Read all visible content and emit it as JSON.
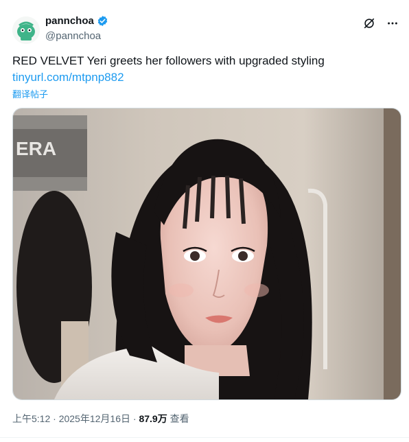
{
  "author": {
    "display_name": "pannchoa",
    "handle": "@pannchoa",
    "verified": true
  },
  "actions": {
    "grok_icon": "slash-circle-icon",
    "more_icon": "more-icon"
  },
  "post": {
    "text": "RED VELVET Yeri greets her followers with upgraded styling",
    "link": "tinyurl.com/mtpnp882",
    "translate_label": "翻译帖子"
  },
  "media": {
    "sign_text": "ERA"
  },
  "footer": {
    "time": "上午5:12",
    "sep1": " · ",
    "date": "2025年12月16日",
    "sep2": " · ",
    "views": "87.9万",
    "views_label": " 查看"
  },
  "colors": {
    "link": "#1d9bf0",
    "verified": "#1d9bf0",
    "secondary_text": "#536471"
  }
}
